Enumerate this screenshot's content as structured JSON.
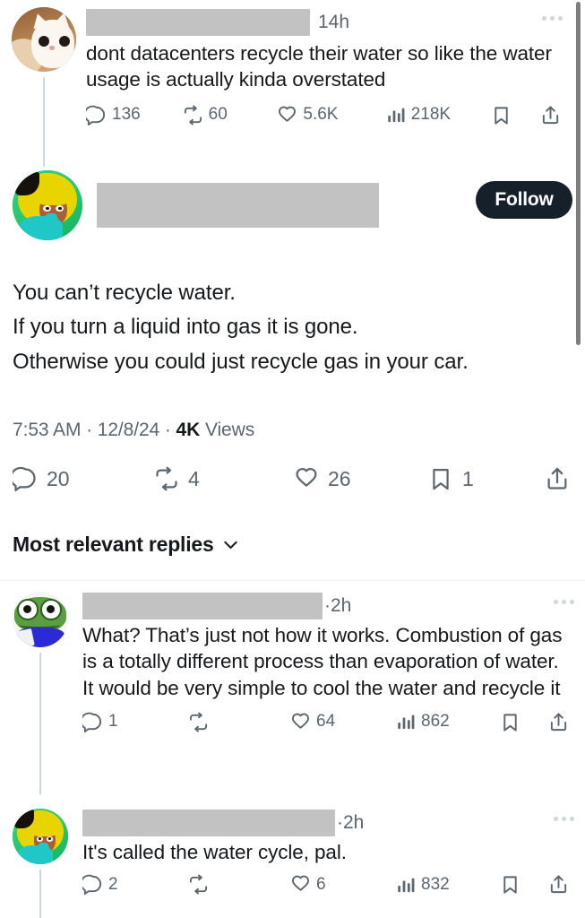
{
  "scrollbar": {
    "visible": true
  },
  "parent_tweet": {
    "avatar_name": "cat-avatar",
    "author_redacted": true,
    "time": "14h",
    "text": "dont datacenters recycle their water so like the water usage is actually kinda overstated",
    "actions": {
      "reply": "136",
      "retweet": "60",
      "like": "5.6K",
      "views": "218K",
      "bookmark": "",
      "share": ""
    }
  },
  "focus_tweet": {
    "avatar_name": "toon-avatar",
    "author_redacted": true,
    "follow_label": "Follow",
    "text_lines": [
      "You can’t recycle water.",
      "If you turn a liquid into gas it is gone.",
      "Otherwise you could just recycle gas in your car."
    ],
    "meta": {
      "time": "7:53 AM",
      "sep1": "·",
      "date": "12/8/24",
      "sep2": "·",
      "views_count": "4K",
      "views_label": "Views"
    },
    "actions": {
      "reply": "20",
      "retweet": "4",
      "like": "26",
      "bookmark": "1",
      "share": ""
    }
  },
  "replies_header": {
    "label": "Most relevant replies",
    "chevron": "chevron-down-icon"
  },
  "replies": [
    {
      "avatar_name": "pepe-avatar",
      "author_redacted": true,
      "time_prefix": "·",
      "time": "2h",
      "text": "What? That’s just not how it works. Combustion of gas is a totally different process than evaporation of water. It would be very simple to cool the water and recycle it",
      "actions": {
        "reply": "1",
        "retweet": "",
        "like": "64",
        "views": "862",
        "bookmark": "",
        "share": ""
      }
    },
    {
      "avatar_name": "toon-avatar",
      "author_redacted": true,
      "time_prefix": "·",
      "time": "2h",
      "text": "It's called the water cycle, pal.",
      "actions": {
        "reply": "2",
        "retweet": "",
        "like": "6",
        "views": "832",
        "bookmark": "",
        "share": ""
      }
    }
  ],
  "colors": {
    "text_primary": "#16191c",
    "text_secondary": "#5a6670",
    "redaction": "#c2c2c2",
    "follow_bg": "#15202b",
    "thread_line": "#cfd9de",
    "divider": "#eceef0"
  }
}
